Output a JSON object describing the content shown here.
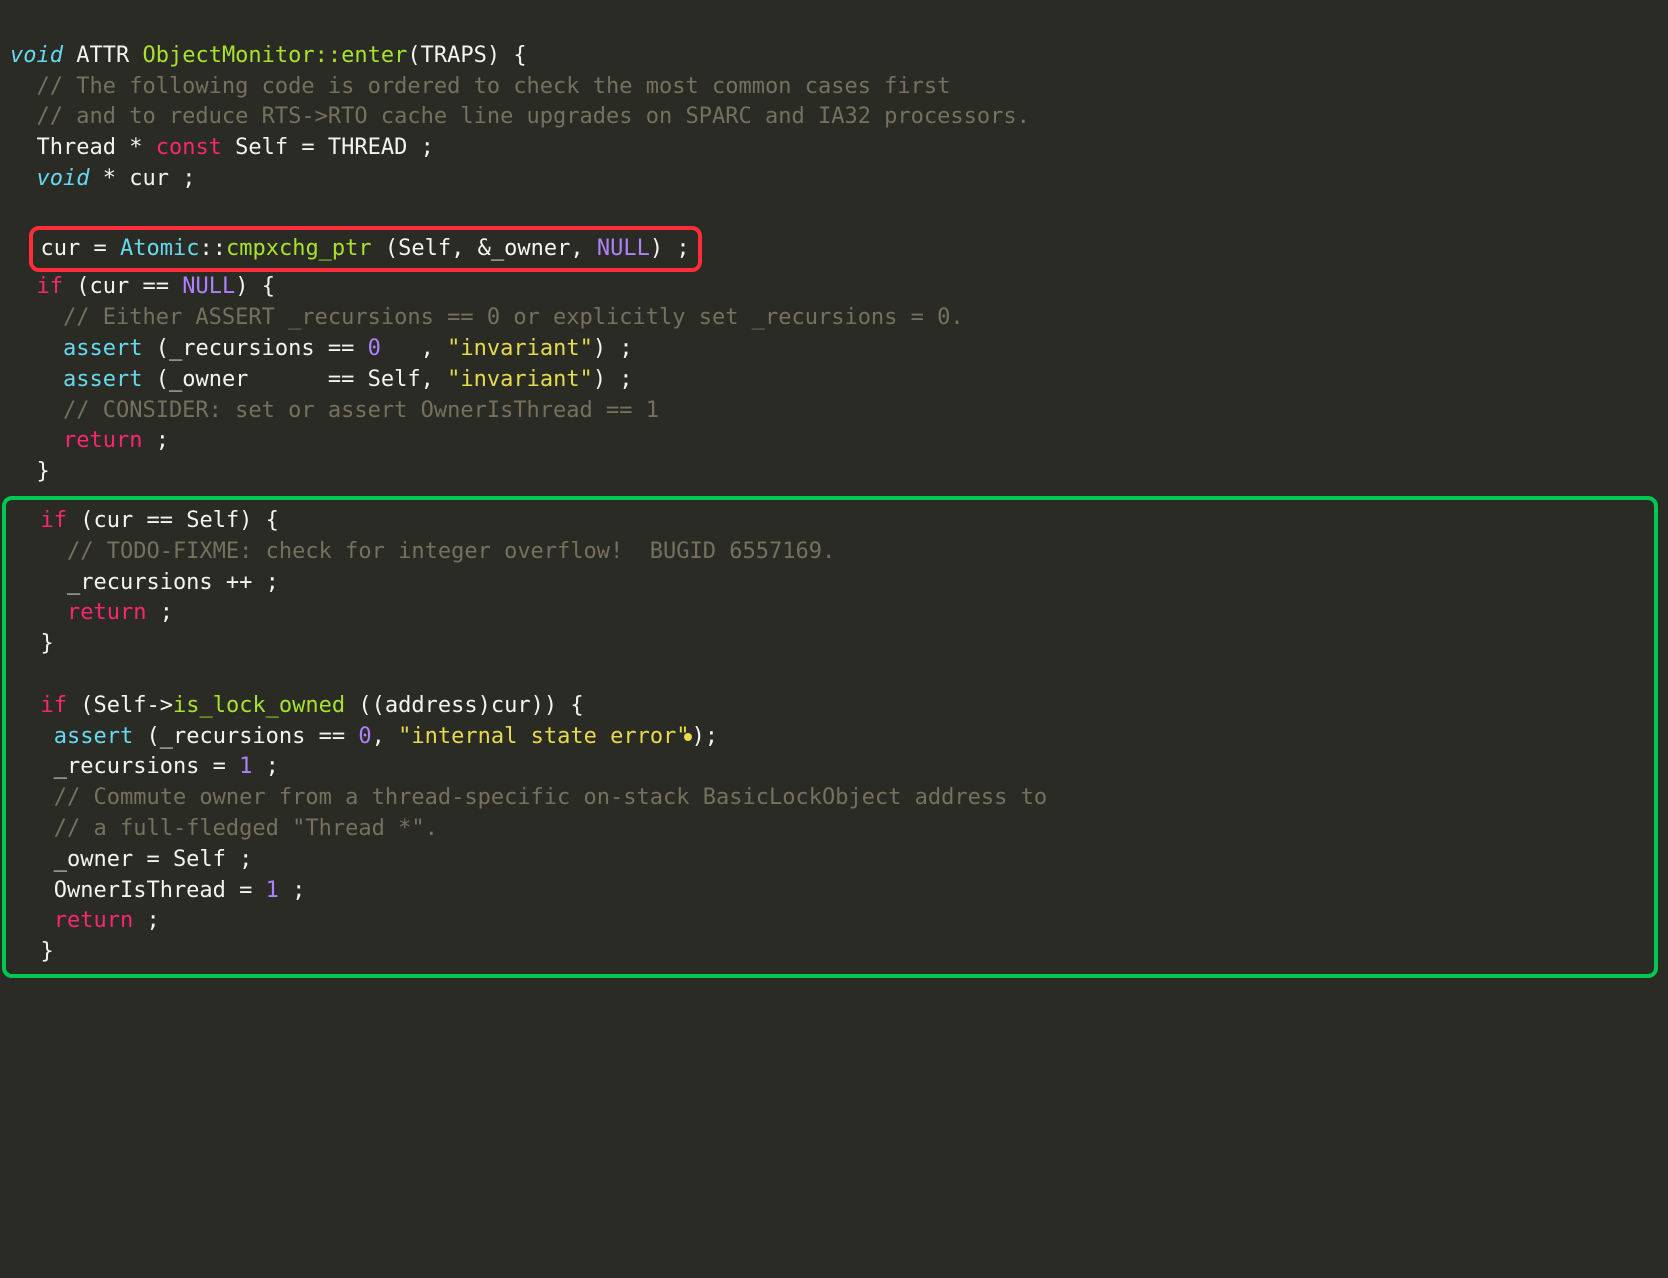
{
  "sig": {
    "void": "void",
    "attr": " ATTR ",
    "cls": "ObjectMonitor",
    "dcolon": "::",
    "enter": "enter",
    "traps": "(TRAPS) {"
  },
  "c1": "  // The following code is ordered to check the most common cases first",
  "c2": "  // and to reduce RTS->RTO cache line upgrades on SPARC and IA32 processors.",
  "l_self": {
    "a": "  Thread * ",
    "const": "const",
    "b": " Self = THREAD ;"
  },
  "l_voidcur": {
    "void": "void",
    "rest": " * cur ;"
  },
  "red": {
    "a": "cur = ",
    "atomic": "Atomic",
    "dcolon": "::",
    "fn": "cmpxchg_ptr",
    "mid": " (Self, &_owner, ",
    "null": "NULL",
    "end": ") ;"
  },
  "ifnull": {
    "if": "if",
    "a": " (cur == ",
    "null": "NULL",
    "b": ") {"
  },
  "c3": "    // Either ASSERT _recursions == 0 or explicitly set _recursions = 0.",
  "assert1": {
    "kw": "assert",
    "a": " (_recursions == ",
    "zero": "0",
    "b": "   , ",
    "str": "\"invariant\"",
    "c": ") ;"
  },
  "assert2": {
    "kw": "assert",
    "a": " (_owner      == Self, ",
    "str": "\"invariant\"",
    "c": ") ;"
  },
  "c4": "    // CONSIDER: set or assert OwnerIsThread == 1",
  "ret": "return",
  "semi": " ;",
  "brace_close": "  }",
  "ifself": {
    "if": "if",
    "a": " (cur == Self) {"
  },
  "c5": "    // TODO-FIXME: check for integer overflow!  BUGID 6557169.",
  "recinc": "    _recursions ++ ;",
  "iflock": {
    "if": "if",
    "a": " (Self->",
    "fn": "is_lock_owned",
    "b": " ((address)cur)) {"
  },
  "assert3": {
    "kw": "assert",
    "a": " (_recursions == ",
    "zero": "0",
    "b": ", ",
    "str": "\"internal state error\"",
    "c": ");"
  },
  "rec1": "   _recursions = ",
  "one": "1",
  "semisp": " ;",
  "c6": "   // Commute owner from a thread-specific on-stack BasicLockObject address to",
  "c7": "   // a full-fledged \"Thread *\".",
  "ownself": "   _owner = Self ;",
  "oit": "   OwnerIsThread = ",
  "ret_ind3": "   ",
  "close2": "  }"
}
